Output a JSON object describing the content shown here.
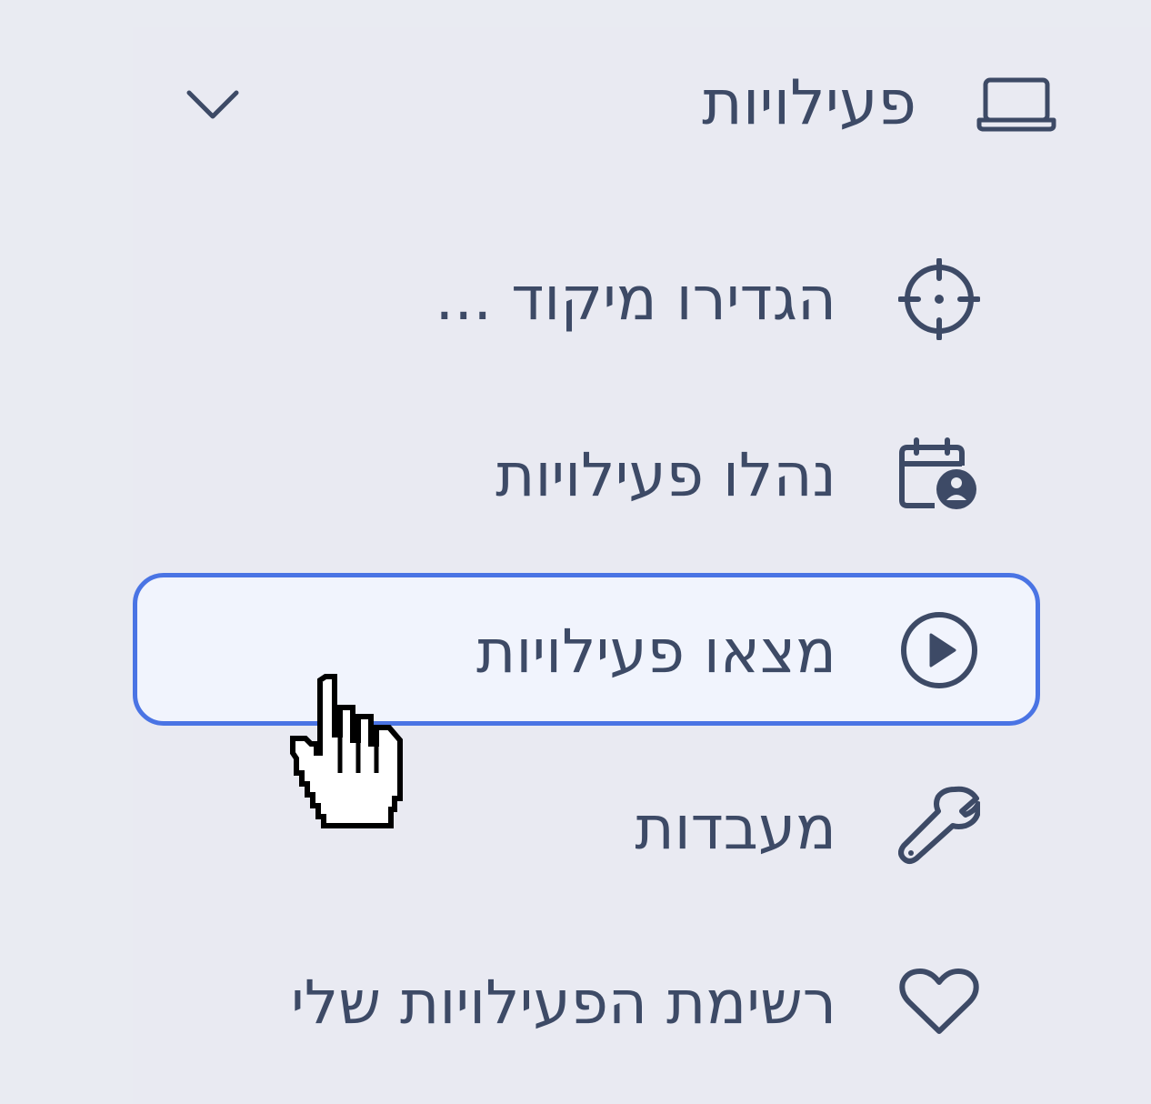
{
  "menu": {
    "section": {
      "label": "פעילויות",
      "icon": "laptop-icon",
      "toggle_icon": "chevron-down-icon"
    },
    "items": [
      {
        "label": "הגדירו מיקוד ...",
        "icon": "crosshair-icon"
      },
      {
        "label": "נהלו פעילויות",
        "icon": "calendar-user-icon"
      },
      {
        "label": "מצאו פעילויות",
        "icon": "play-circle-icon",
        "selected": true
      },
      {
        "label": "מעבדות",
        "icon": "wrench-icon"
      },
      {
        "label": "רשימת הפעילויות שלי",
        "icon": "heart-icon"
      }
    ]
  },
  "colors": {
    "text": "#3d4a66",
    "selected_border": "#4a74e4",
    "selected_bg": "#f1f4fd",
    "background": "#e9eaf2"
  },
  "cursor": "pointer-hand-icon"
}
